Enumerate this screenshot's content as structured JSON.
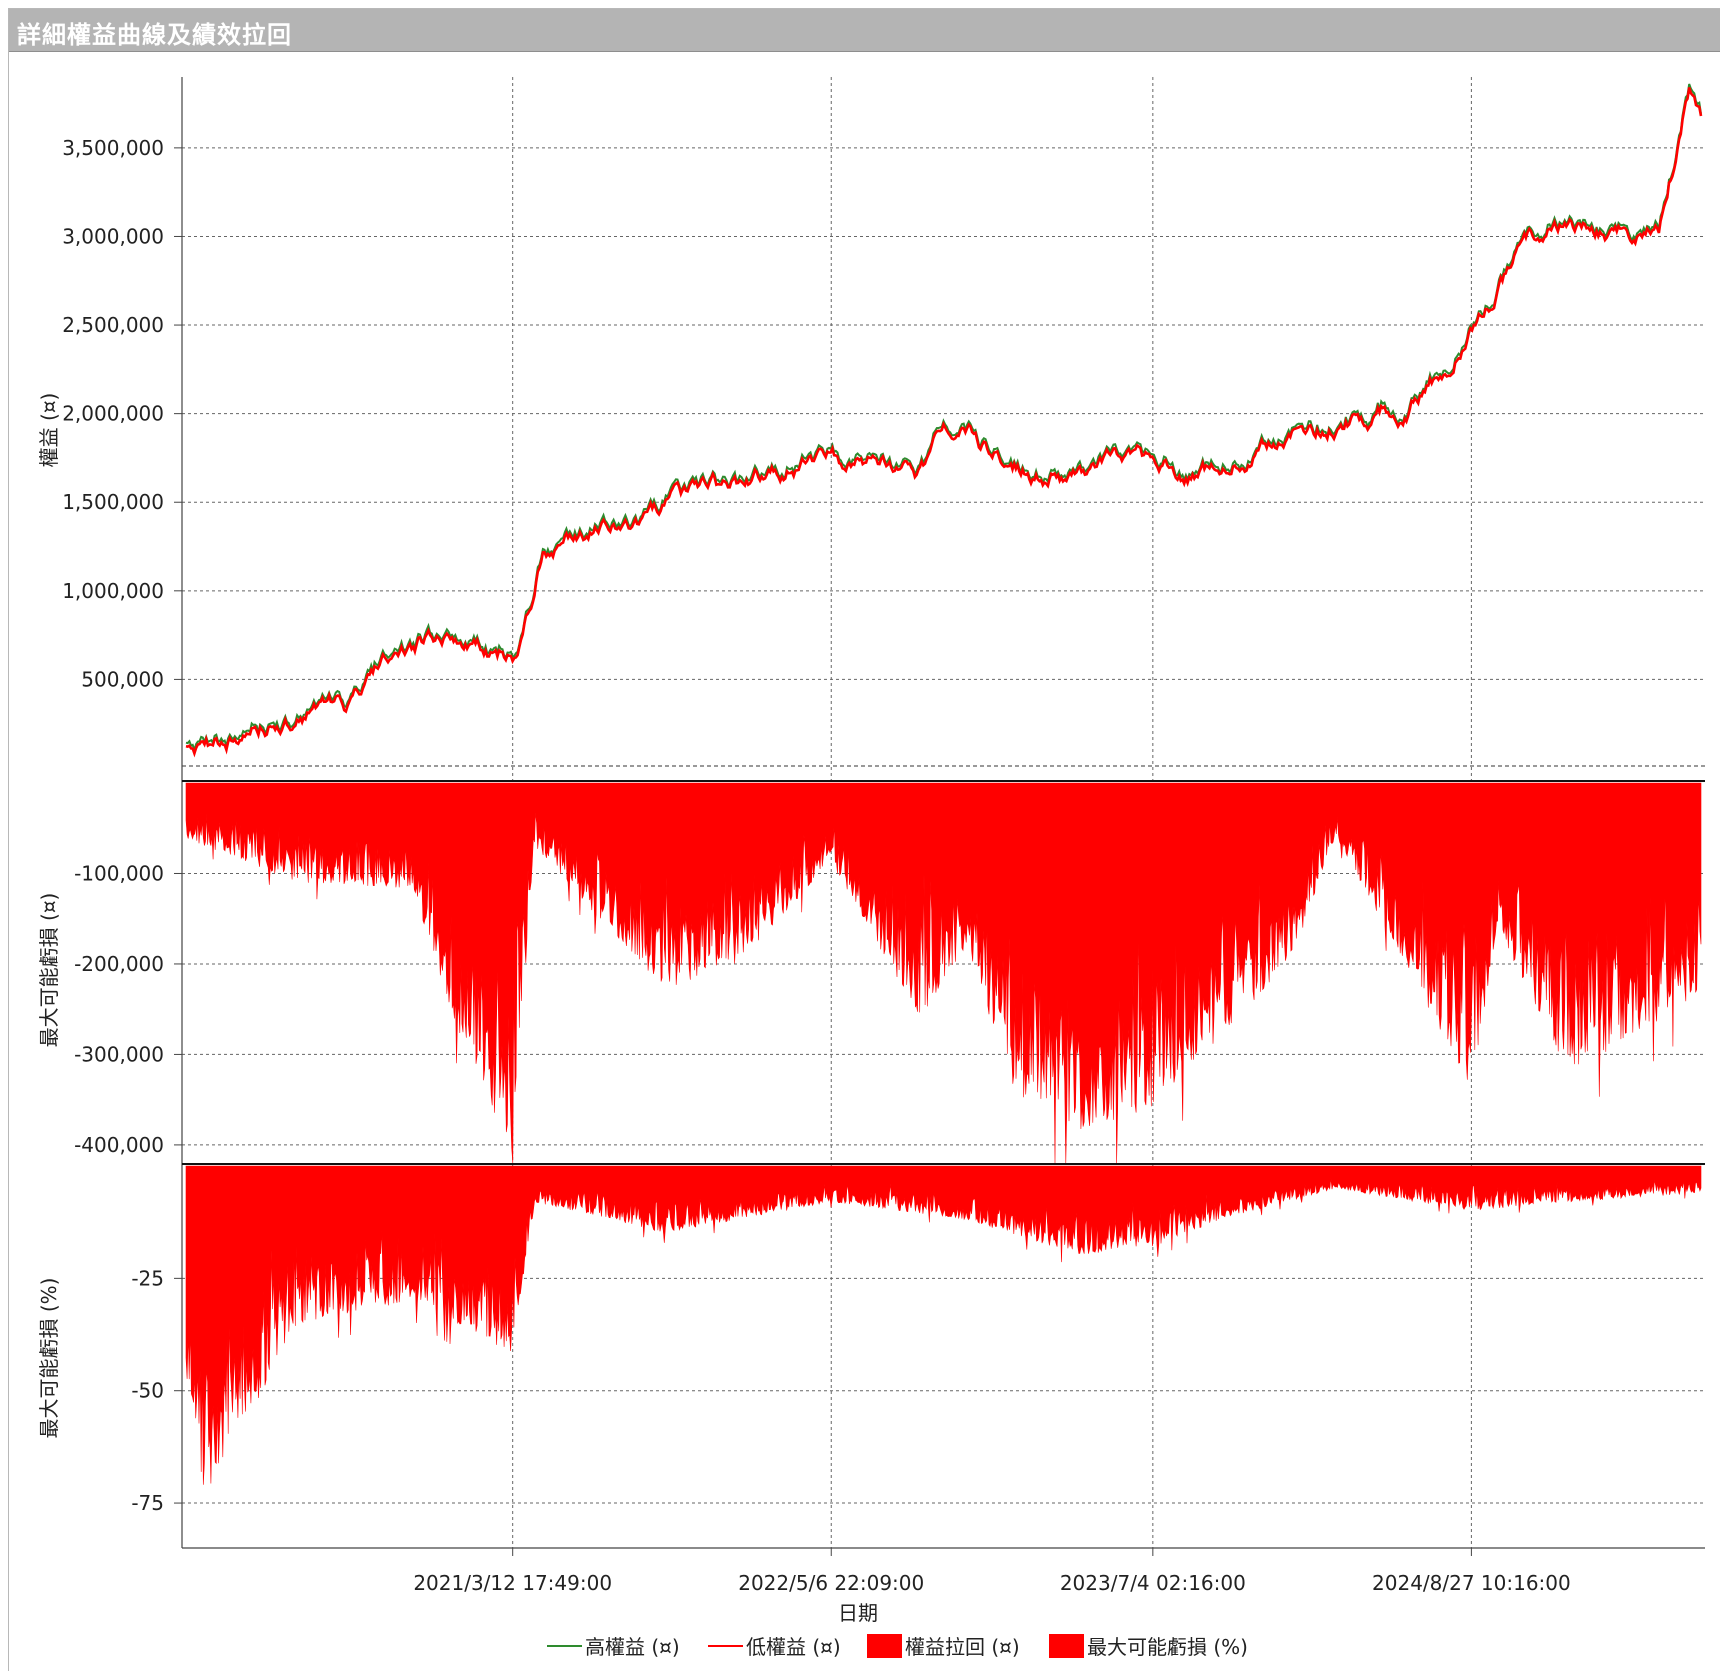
{
  "window_title": "詳細權益曲線及績效拉回",
  "colors": {
    "high_equity": "#2e8b2e",
    "low_equity": "#ff0000",
    "fill": "#ff0000",
    "grid": "#555555"
  },
  "chart_data": [
    {
      "type": "line",
      "ylabel": "權益 (¤)",
      "yticks": [
        "500,000",
        "1,000,000",
        "1,500,000",
        "2,000,000",
        "2,500,000",
        "3,000,000",
        "3,500,000"
      ],
      "ytick_values": [
        500000,
        1000000,
        1500000,
        2000000,
        2500000,
        3000000,
        3500000
      ],
      "ylim": [
        0,
        3900000
      ],
      "series": [
        {
          "name": "高權益 (¤)",
          "color": "#2e8b2e"
        },
        {
          "name": "低權益 (¤)",
          "color": "#ff0000"
        }
      ],
      "x": [
        "2020/1/1",
        "2020/2/1",
        "2020/5/1",
        "2020/8/1",
        "2020/9/15",
        "2020/12/1",
        "2021/3/12",
        "2021/4/10",
        "2021/4/20",
        "2021/7/1",
        "2021/10/1",
        "2022/1/1",
        "2022/5/6",
        "2022/9/1",
        "2022/10/15",
        "2023/1/1",
        "2023/4/1",
        "2023/7/4",
        "2023/10/1",
        "2024/1/1",
        "2024/3/1",
        "2024/6/1",
        "2024/7/20",
        "2024/8/27",
        "2024/11/1",
        "2025/1/1",
        "2025/3/1",
        "2025/5/1",
        "2025/6/10",
        "2025/7/1"
      ],
      "values": [
        120000,
        90000,
        280000,
        330000,
        520000,
        750000,
        640000,
        1050000,
        1250000,
        1380000,
        1450000,
        1580000,
        1750000,
        1650000,
        1900000,
        1720000,
        1620000,
        1690000,
        1720000,
        1800000,
        1960000,
        2050000,
        2250000,
        2500000,
        2900000,
        3100000,
        3000000,
        3050000,
        3850000,
        3650000
      ]
    },
    {
      "type": "area",
      "ylabel": "最大可能虧損 (¤)",
      "series_name": "權益拉回 (¤)",
      "yticks": [
        "-100,000",
        "-200,000",
        "-300,000",
        "-400,000"
      ],
      "ytick_values": [
        -100000,
        -200000,
        -300000,
        -400000
      ],
      "ylim": [
        -420000,
        0
      ],
      "x": [
        "2020/1/1",
        "2020/6/1",
        "2020/11/1",
        "2021/1/1",
        "2021/3/12",
        "2021/4/10",
        "2021/6/1",
        "2021/10/1",
        "2022/1/1",
        "2022/5/6",
        "2022/9/1",
        "2022/11/1",
        "2023/1/1",
        "2023/4/1",
        "2023/7/4",
        "2023/10/1",
        "2024/1/1",
        "2024/3/1",
        "2024/6/1",
        "2024/8/27",
        "2024/10/1",
        "2025/1/1",
        "2025/4/1",
        "2025/7/1"
      ],
      "values": [
        -60000,
        -110000,
        -120000,
        -280000,
        -410000,
        -70000,
        -120000,
        -230000,
        -200000,
        -90000,
        -260000,
        -180000,
        -340000,
        -390000,
        -360000,
        -280000,
        -200000,
        -60000,
        -200000,
        -340000,
        -160000,
        -320000,
        -280000,
        -230000
      ]
    },
    {
      "type": "area",
      "ylabel": "最大可能虧損 (%)",
      "series_name": "最大可能虧損 (%)",
      "yticks": [
        "-25",
        "-50",
        "-75"
      ],
      "ytick_values": [
        -25,
        -50,
        -75
      ],
      "ylim": [
        -85,
        0
      ],
      "x": [
        "2020/1/1",
        "2020/2/1",
        "2020/3/1",
        "2020/6/1",
        "2020/11/1",
        "2021/3/12",
        "2021/4/10",
        "2021/10/1",
        "2022/5/6",
        "2022/11/1",
        "2023/4/1",
        "2023/7/4",
        "2023/10/1",
        "2024/3/1",
        "2024/8/27",
        "2025/1/1",
        "2025/7/1"
      ],
      "values": [
        -40,
        -75,
        -65,
        -35,
        -30,
        -42,
        -8,
        -15,
        -8,
        -12,
        -20,
        -18,
        -12,
        -5,
        -10,
        -8,
        -6
      ]
    }
  ],
  "x_axis": {
    "xlabel": "日期",
    "ticks": [
      "2021/3/12 17:49:00",
      "2022/5/6 22:09:00",
      "2023/7/4 02:16:00",
      "2024/8/27 10:16:00"
    ],
    "tick_dates": [
      "2021/3/12",
      "2022/5/6",
      "2023/7/4",
      "2024/8/27"
    ],
    "range": [
      "2020/1/1",
      "2025/7/1"
    ]
  },
  "legend": [
    "高權益 (¤)",
    "低權益 (¤)",
    "權益拉回 (¤)",
    "最大可能虧損 (%)"
  ]
}
